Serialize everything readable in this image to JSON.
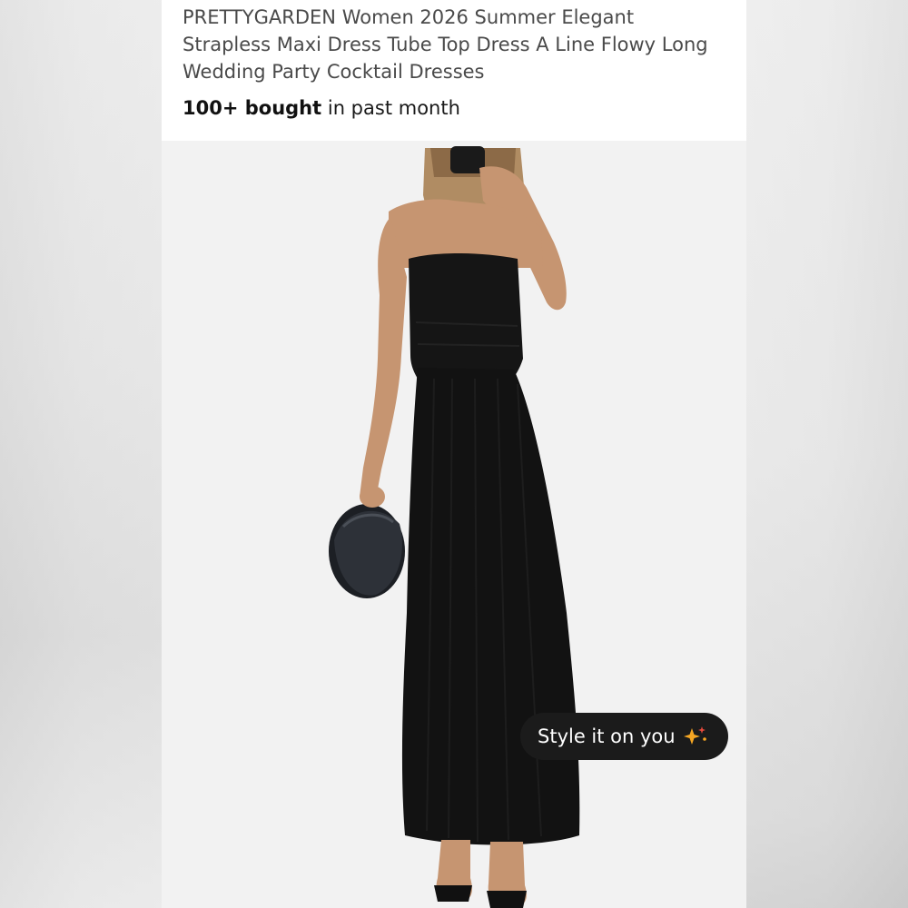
{
  "product": {
    "title": "PRETTYGARDEN Women 2026 Summer Elegant Strapless Maxi Dress Tube Top Dress A Line Flowy Long Wedding Party Cocktail Dresses",
    "bought_count": "100+ bought",
    "bought_suffix": " in past month"
  },
  "style_button": {
    "label": "Style it on you",
    "icon": "sparkle-icon"
  },
  "colors": {
    "panel_bg": "#ffffff",
    "image_bg": "#f2f2f2",
    "button_bg": "#1b1b1b",
    "sparkle_primary": "#f5a623",
    "sparkle_secondary": "#e84a3c"
  }
}
